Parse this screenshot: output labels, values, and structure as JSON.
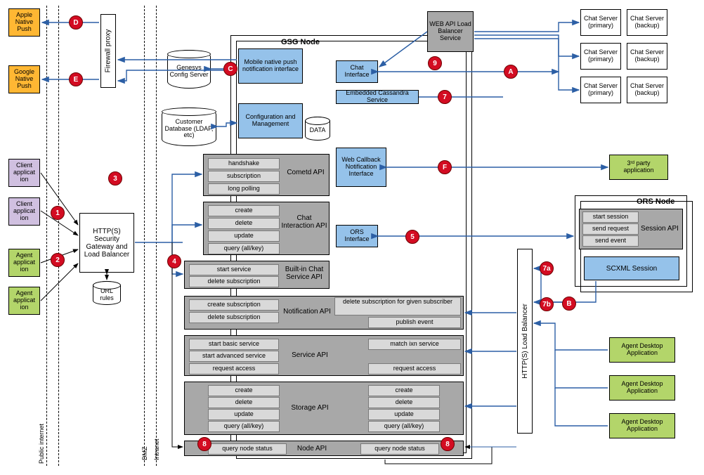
{
  "pushApple": "Apple Native Push",
  "pushGoogle": "Google Native Push",
  "firewall": "Firewall proxy",
  "genesysCfg": "Genesys Config Server",
  "custDb": "Customer Database (LDAP, etc)",
  "dataCyl": "DATA",
  "clientApp": "Client applicat ion",
  "agentApp": "Agent applicat ion",
  "gateway": "HTTP(S) Security Gateway and Load Balancer",
  "urlRules": "URL rules",
  "gsgTitle": "GSG Node",
  "mobilePush": "Mobile native push notification interface",
  "cfgMgmt": "Configuration and Management",
  "chatIf": "Chat Interface",
  "embCass": "Embedded Cassandra Service",
  "webCb": "Web Callback Notification Interface",
  "orsIf": "ORS Interface",
  "webApiLb": "WEB API Load Balancer Service",
  "cometd": {
    "name": "Cometd API",
    "rows": [
      "handshake",
      "subscription",
      "long polling"
    ]
  },
  "chatIxn": {
    "name": "Chat Interaction API",
    "rows": [
      "create",
      "delete",
      "update",
      "query (all/key)"
    ]
  },
  "builtIn": {
    "name": "Built-in Chat Service API",
    "rows": [
      "start service",
      "delete subscription"
    ]
  },
  "notif": {
    "name": "Notification API",
    "left": [
      "create subscription",
      "delete subscription"
    ],
    "right": [
      "delete subscription for given subscriber",
      "publish event"
    ]
  },
  "svc": {
    "name": "Service API",
    "left": [
      "start basic service",
      "start advanced service",
      "request access"
    ],
    "right": [
      "match ixn service",
      "",
      "request access"
    ]
  },
  "storage": {
    "name": "Storage API",
    "left": [
      "create",
      "delete",
      "update",
      "query (all/key)"
    ],
    "right": [
      "create",
      "delete",
      "update",
      "query (all/key)"
    ]
  },
  "node": {
    "name": "Node API",
    "left": "query node status",
    "right": "query node status"
  },
  "chatPrimary": "Chat Server (primary)",
  "chatBackup": "Chat Server (backup)",
  "thirdParty": "3ʳᵈ party application",
  "orsTitle": "ORS Node",
  "sessionApi": {
    "name": "Session API",
    "rows": [
      "start session",
      "send request",
      "send event"
    ]
  },
  "scxml": "SCXML Session",
  "httpLb": "HTTP(S) Load Balancer",
  "agentDesktop": "Agent Desktop Application",
  "regions": {
    "public": "Public internet",
    "dmz": "DMZ",
    "intranet": "Intranet"
  },
  "badges": {
    "1": "1",
    "2": "2",
    "3": "3",
    "4": "4",
    "5": "5",
    "7": "7",
    "7a": "7a",
    "7b": "7b",
    "8": "8",
    "9": "9",
    "A": "A",
    "B": "B",
    "C": "C",
    "D": "D",
    "E": "E",
    "F": "F"
  }
}
